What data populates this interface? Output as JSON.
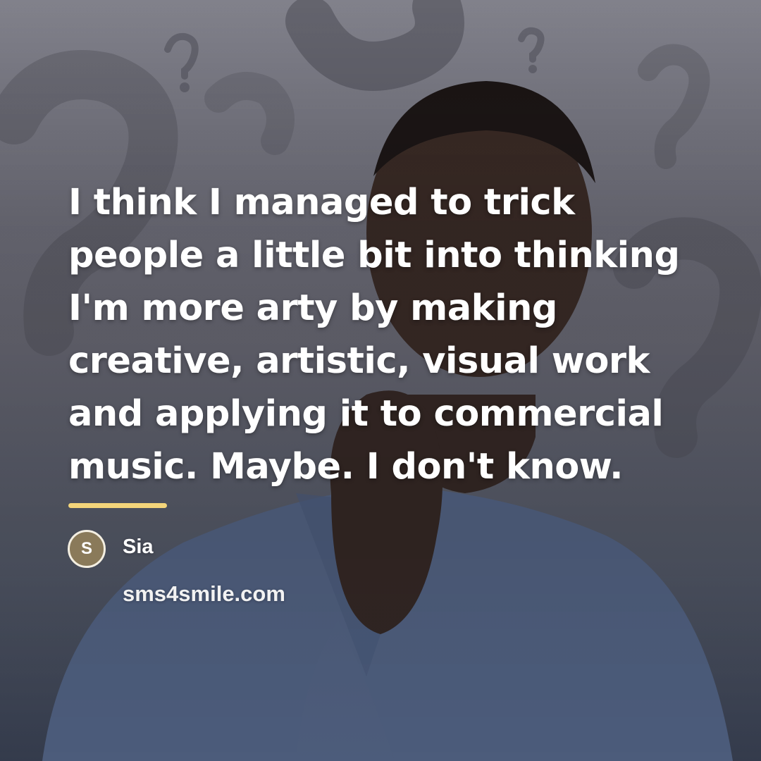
{
  "background": {
    "description_icon": "thinking-person-with-question-marks",
    "colors": {
      "backdrop": "#8e8e98",
      "shirt": "#5f7397",
      "skin": "#3a2a22",
      "question_mark": "#55555e"
    }
  },
  "quote": {
    "lines": [
      "I think I managed to trick",
      "people a little bit into thinking",
      "I'm more arty by making",
      "creative, artistic, visual work",
      "and applying it to commercial",
      "music. Maybe. I don't know."
    ],
    "color": "#ffffff"
  },
  "divider": {
    "color": "#f4d57a"
  },
  "author": {
    "initial": "S",
    "name": "Sia",
    "avatar_color": "#8a7a5a"
  },
  "site": {
    "label": "sms4smile.com"
  }
}
